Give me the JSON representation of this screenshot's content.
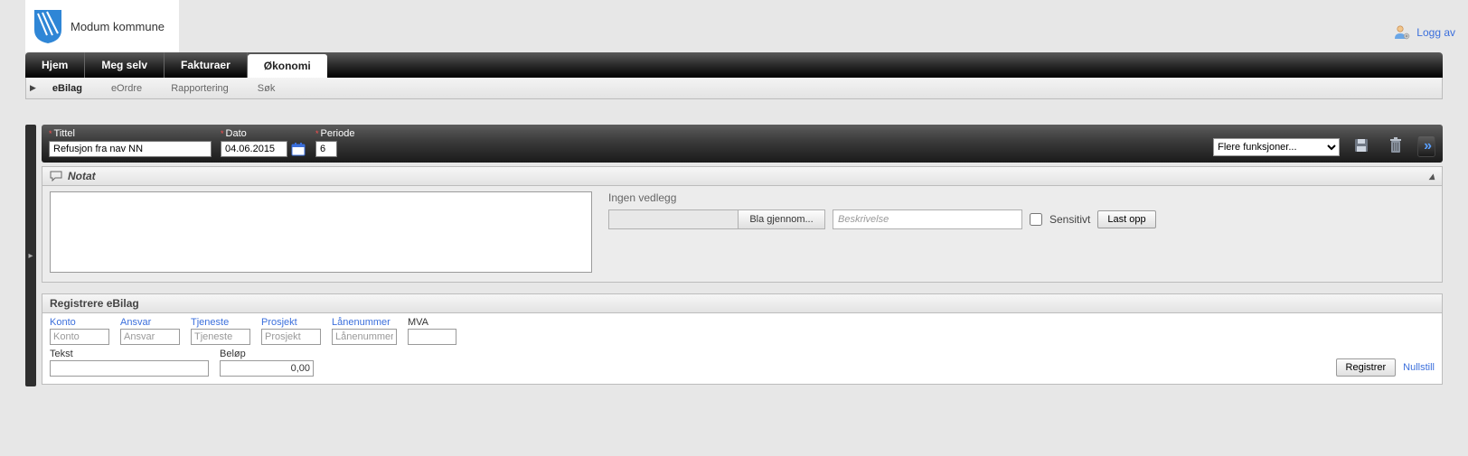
{
  "brand": {
    "name": "Modum kommune"
  },
  "logoff": {
    "label": "Logg av"
  },
  "mainnav": {
    "tabs": [
      {
        "label": "Hjem"
      },
      {
        "label": "Meg selv"
      },
      {
        "label": "Fakturaer"
      },
      {
        "label": "Økonomi"
      }
    ],
    "active_index": 3
  },
  "subnav": {
    "items": [
      {
        "label": "eBilag"
      },
      {
        "label": "eOrdre"
      },
      {
        "label": "Rapportering"
      },
      {
        "label": "Søk"
      }
    ],
    "active_index": 0
  },
  "header": {
    "tittel_label": "Tittel",
    "tittel_value": "Refusjon fra nav NN",
    "dato_label": "Dato",
    "dato_value": "04.06.2015",
    "periode_label": "Periode",
    "periode_value": "6",
    "more_select": "Flere funksjoner..."
  },
  "notat": {
    "title": "Notat",
    "value": "",
    "vedlegg_label": "Ingen vedlegg",
    "browse_label": "Bla gjennom...",
    "desc_placeholder": "Beskrivelse",
    "sensitiv_label": "Sensitivt",
    "upload_label": "Last opp"
  },
  "register": {
    "title": "Registrere eBilag",
    "cols": {
      "konto": {
        "label": "Konto",
        "placeholder": "Konto"
      },
      "ansvar": {
        "label": "Ansvar",
        "placeholder": "Ansvar"
      },
      "tjeneste": {
        "label": "Tjeneste",
        "placeholder": "Tjeneste"
      },
      "prosjekt": {
        "label": "Prosjekt",
        "placeholder": "Prosjekt"
      },
      "lanenr": {
        "label": "Lånenummer",
        "placeholder": "Lånenummer"
      },
      "mva": {
        "label": "MVA",
        "placeholder": ""
      },
      "tekst": {
        "label": "Tekst",
        "value": ""
      },
      "belop": {
        "label": "Beløp",
        "value": "0,00"
      }
    },
    "register_btn": "Registrer",
    "reset_link": "Nullstill"
  }
}
